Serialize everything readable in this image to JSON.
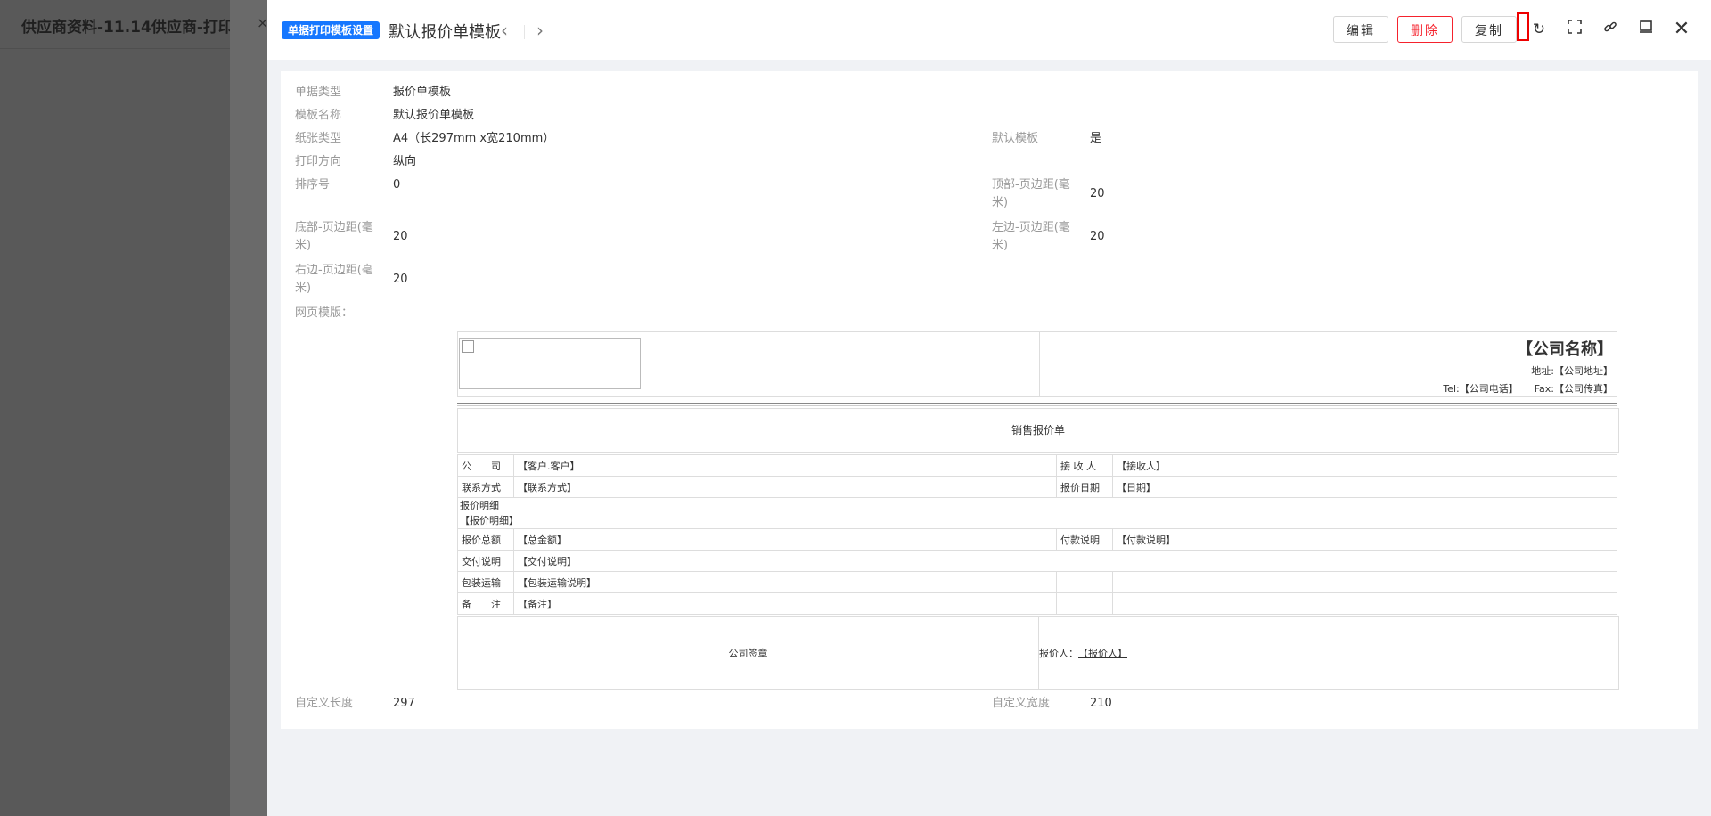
{
  "background": {
    "title": "供应商资料-11.14供应商-打印",
    "close_glyph": "×"
  },
  "header": {
    "tag": "单据打印模板设置",
    "title": "默认报价单模板",
    "prev_icon": "chevron-left-icon",
    "next_icon": "chevron-right-icon",
    "buttons": {
      "edit": "编辑",
      "delete": "删除",
      "copy": "复制"
    },
    "icons": [
      "refresh-icon",
      "fullscreen-icon",
      "link-icon",
      "monitor-icon",
      "close-icon"
    ],
    "colors": {
      "tag": "#1677ff",
      "delete": "#f5222d",
      "highlight": "#e00000"
    }
  },
  "fields": {
    "doc_type": {
      "label": "单据类型",
      "value": "报价单模板"
    },
    "template_name": {
      "label": "模板名称",
      "value": "默认报价单模板"
    },
    "paper_type": {
      "label": "纸张类型",
      "value": "A4（长297mm x宽210mm）"
    },
    "default_template": {
      "label": "默认模板",
      "value": "是"
    },
    "print_direction": {
      "label": "打印方向",
      "value": "纵向"
    },
    "sort_no": {
      "label": "排序号",
      "value": "0"
    },
    "top_margin": {
      "label_1": "顶部-页边距(毫",
      "label_2": "米)",
      "value": "20"
    },
    "bottom_margin": {
      "label_1": "底部-页边距(毫",
      "label_2": "米)",
      "value": "20"
    },
    "left_margin": {
      "label_1": "左边-页边距(毫",
      "label_2": "米)",
      "value": "20"
    },
    "right_margin": {
      "label_1": "右边-页边距(毫",
      "label_2": "米)",
      "value": "20"
    },
    "web_template": {
      "label": "网页模版："
    },
    "custom_length": {
      "label": "自定义长度",
      "value": "297"
    },
    "custom_width": {
      "label": "自定义宽度",
      "value": "210"
    }
  },
  "template": {
    "company_name": "【公司名称】",
    "address": "地址:【公司地址】",
    "tel": "Tel:【公司电话】",
    "fax": "Fax:【公司传真】",
    "heading": "销售报价单",
    "rows": {
      "company_key": "公　　司",
      "company_val": "【客户.客户】",
      "receiver_key": "接 收 人",
      "receiver_val": "【接收人】",
      "contact_key": "联系方式",
      "contact_val": "【联系方式】",
      "date_key": "报价日期",
      "date_val": "【日期】",
      "detail_key": "报价明细",
      "detail_val": "【报价明细】",
      "total_key": "报价总额",
      "total_val": "【总金额】",
      "payment_key": "付款说明",
      "payment_val": "【付款说明】",
      "delivery_key": "交付说明",
      "delivery_val": "【交付说明】",
      "packing_key": "包装运输",
      "packing_val": "【包装运输说明】",
      "remark_key": "备　　注",
      "remark_val": "【备注】"
    },
    "seal": "公司签章",
    "quoter_label": "报价人：",
    "quoter_val": "【报价人】"
  }
}
